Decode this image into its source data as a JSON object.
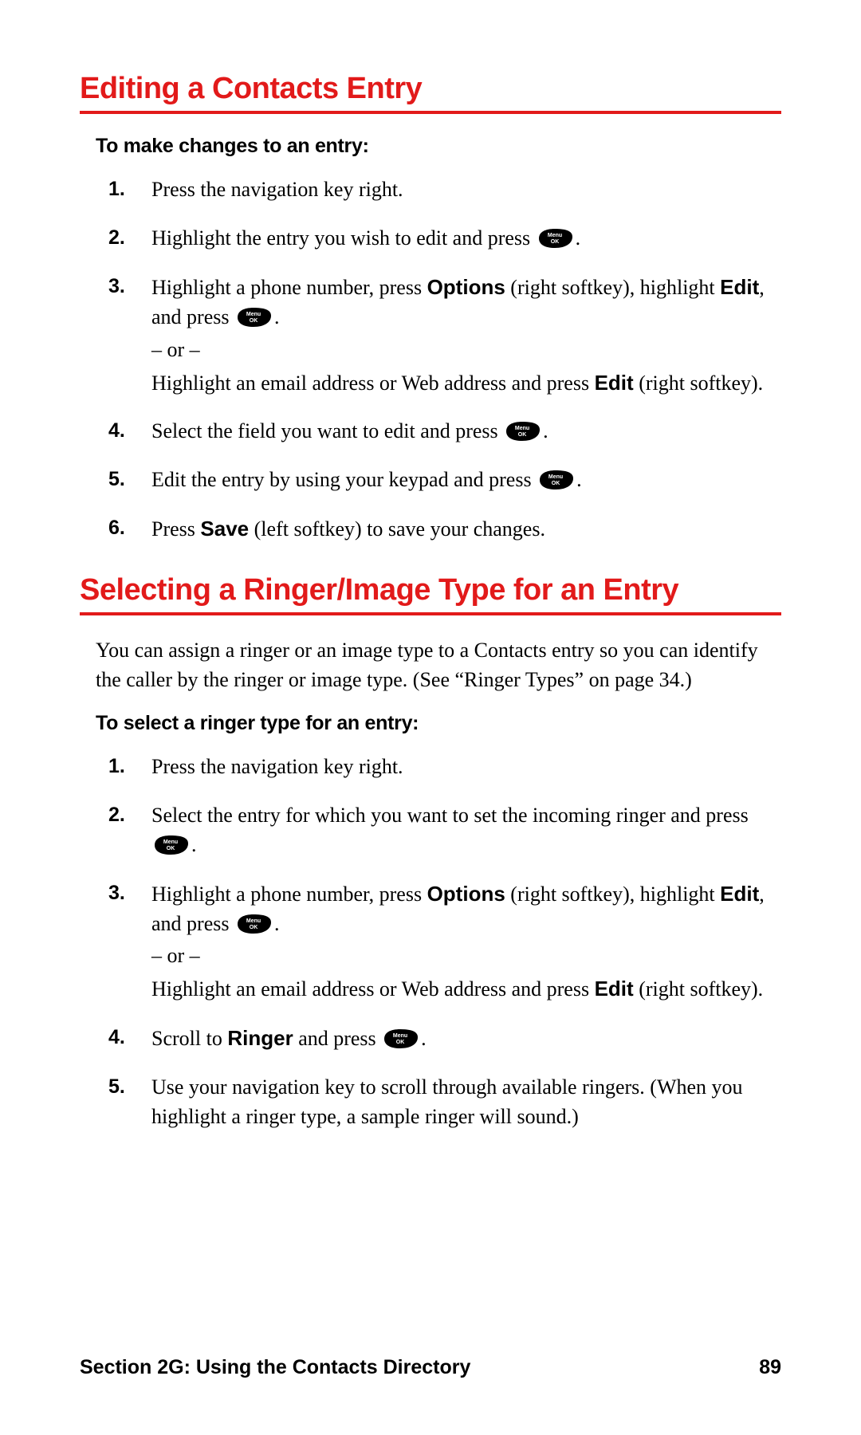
{
  "icon": {
    "menuok": "Menu/OK"
  },
  "section1": {
    "heading": "Editing a Contacts Entry",
    "sub": "To make changes to an entry:",
    "steps": {
      "s1": "Press the navigation key right.",
      "s2a": "Highlight the entry you wish to edit and press ",
      "s2b": ".",
      "s3a": "Highlight a phone number, press ",
      "s3_options": "Options",
      "s3b": " (right softkey), highlight ",
      "s3_edit": "Edit",
      "s3c": ", and press ",
      "s3d": ".",
      "s3_or": "– or –",
      "s3e": "Highlight an email address or Web address and press ",
      "s3_edit2": "Edit",
      "s3f": " (right softkey).",
      "s4a": "Select the field you want to edit and press ",
      "s4b": ".",
      "s5a": "Edit the entry by using your keypad and press ",
      "s5b": ".",
      "s6a": "Press ",
      "s6_save": "Save",
      "s6b": " (left softkey) to save your changes."
    }
  },
  "section2": {
    "heading": "Selecting a Ringer/Image Type for an Entry",
    "intro": "You can assign a ringer or an image type to a Contacts entry so you can identify the caller by the ringer or image type. (See “Ringer Types” on page 34.)",
    "sub": "To select a ringer type for an entry:",
    "steps": {
      "s1": "Press the navigation key right.",
      "s2a": "Select the entry for which you want to set the incoming ringer and press ",
      "s2b": ".",
      "s3a": "Highlight a phone number, press ",
      "s3_options": "Options",
      "s3b": " (right softkey), highlight ",
      "s3_edit": "Edit",
      "s3c": ", and press ",
      "s3d": ".",
      "s3_or": "– or –",
      "s3e": "Highlight an email address or Web address and press ",
      "s3_edit2": "Edit",
      "s3f": " (right softkey).",
      "s4a": "Scroll to ",
      "s4_ringer": "Ringer",
      "s4b": " and press ",
      "s4c": ".",
      "s5": "Use your navigation key to scroll through available ringers. (When you highlight a ringer type, a sample ringer will sound.)"
    }
  },
  "footer": {
    "section": "Section 2G: Using the Contacts Directory",
    "page": "89"
  }
}
